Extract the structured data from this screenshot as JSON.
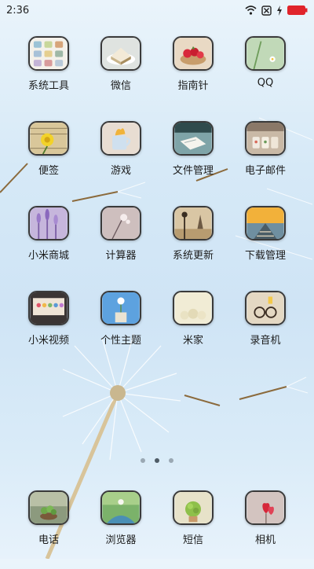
{
  "status_bar": {
    "time": "2:36",
    "icons": [
      "wifi-icon",
      "sim-disabled-icon",
      "charging-icon",
      "battery-low-icon"
    ],
    "battery_color": "#e0242b"
  },
  "apps": [
    {
      "label": "系统工具",
      "icon": "tools-folder-icon"
    },
    {
      "label": "微信",
      "icon": "wechat-icon"
    },
    {
      "label": "指南针",
      "icon": "compass-icon"
    },
    {
      "label": "QQ",
      "icon": "qq-icon"
    },
    {
      "label": "便签",
      "icon": "notes-icon"
    },
    {
      "label": "游戏",
      "icon": "games-icon"
    },
    {
      "label": "文件管理",
      "icon": "file-manager-icon"
    },
    {
      "label": "电子邮件",
      "icon": "email-icon"
    },
    {
      "label": "小米商城",
      "icon": "mi-store-icon"
    },
    {
      "label": "计算器",
      "icon": "calculator-icon"
    },
    {
      "label": "系统更新",
      "icon": "system-update-icon"
    },
    {
      "label": "下载管理",
      "icon": "downloads-icon"
    },
    {
      "label": "小米视频",
      "icon": "mi-video-icon"
    },
    {
      "label": "个性主题",
      "icon": "themes-icon"
    },
    {
      "label": "米家",
      "icon": "mi-home-icon"
    },
    {
      "label": "录音机",
      "icon": "recorder-icon"
    }
  ],
  "page_indicator": {
    "pages": 3,
    "current": 2
  },
  "dock": [
    {
      "label": "电话",
      "icon": "phone-icon"
    },
    {
      "label": "浏览器",
      "icon": "browser-icon"
    },
    {
      "label": "短信",
      "icon": "messages-icon"
    },
    {
      "label": "相机",
      "icon": "camera-icon"
    }
  ]
}
